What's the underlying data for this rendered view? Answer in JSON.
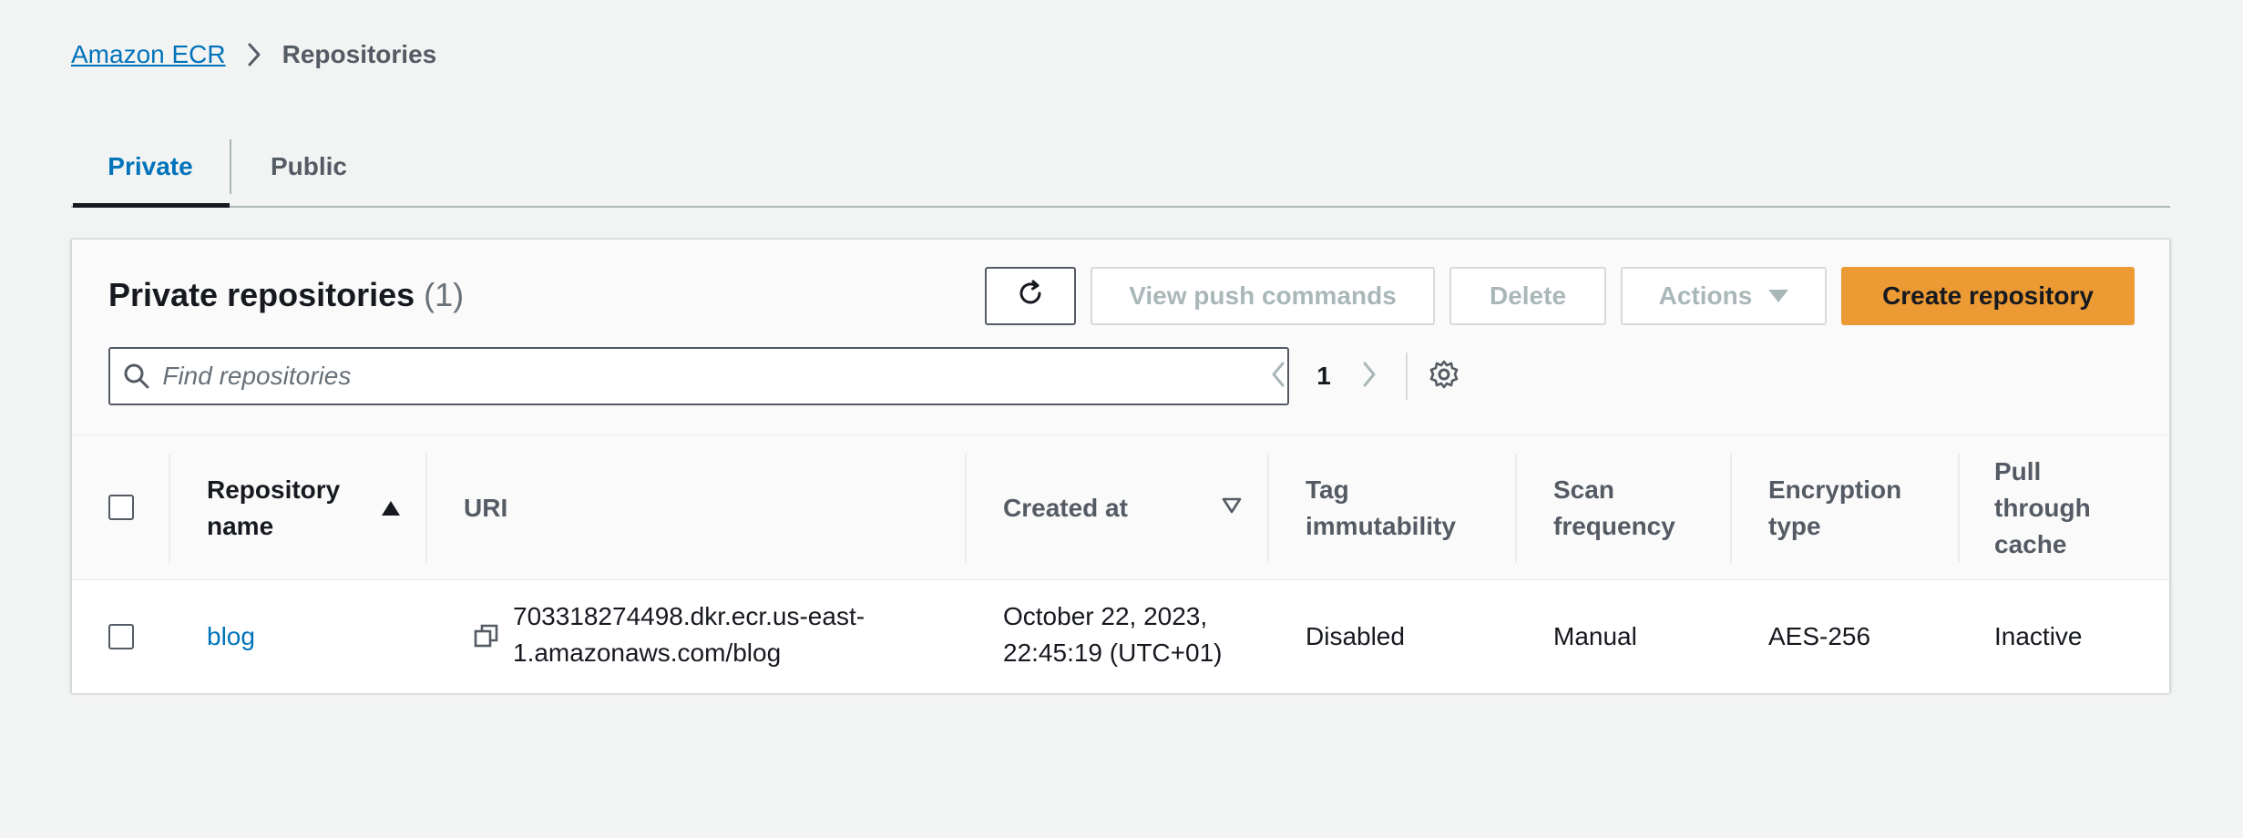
{
  "breadcrumb": {
    "root": "Amazon ECR",
    "current": "Repositories"
  },
  "tabs": [
    {
      "label": "Private",
      "active": true
    },
    {
      "label": "Public",
      "active": false
    }
  ],
  "panel": {
    "title": "Private repositories",
    "count": "(1)"
  },
  "toolbar": {
    "refresh_icon": "refresh-icon",
    "push_label": "View push commands",
    "delete_label": "Delete",
    "actions_label": "Actions",
    "create_label": "Create repository"
  },
  "search": {
    "placeholder": "Find repositories",
    "value": ""
  },
  "pagination": {
    "current_page": "1"
  },
  "table": {
    "headers": {
      "name": [
        "Repository",
        "name"
      ],
      "uri": "URI",
      "created": "Created at",
      "tag": [
        "Tag",
        "immutability"
      ],
      "scan": [
        "Scan",
        "frequency"
      ],
      "encryption": [
        "Encryption",
        "type"
      ],
      "pull": [
        "Pull",
        "through",
        "cache"
      ]
    },
    "rows": [
      {
        "name": "blog",
        "uri_line1": "703318274498.dkr.ecr.us-east-",
        "uri_line2": "1.amazonaws.com/blog",
        "created_line1": "October 22, 2023,",
        "created_line2": "22:45:19 (UTC+01)",
        "tag_immutability": "Disabled",
        "scan_frequency": "Manual",
        "encryption_type": "AES-256",
        "pull_through_cache": "Inactive"
      }
    ]
  },
  "colors": {
    "link": "#0073bb",
    "primary_button": "#ec9a34",
    "background": "#f2f3f3"
  }
}
